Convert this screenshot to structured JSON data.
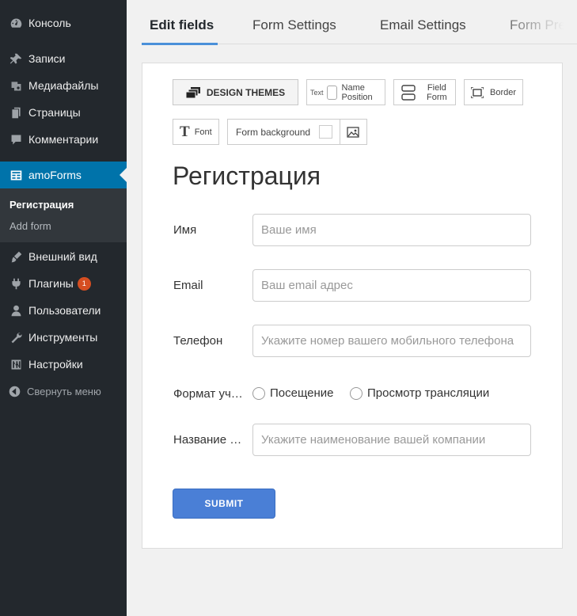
{
  "sidebar": {
    "items": [
      {
        "label": "Консоль",
        "icon": "dashboard-icon"
      },
      {
        "label": "Записи",
        "icon": "pin-icon"
      },
      {
        "label": "Медиафайлы",
        "icon": "media-icon"
      },
      {
        "label": "Страницы",
        "icon": "pages-icon"
      },
      {
        "label": "Комментарии",
        "icon": "comments-icon"
      },
      {
        "label": "amoForms",
        "icon": "forms-icon"
      },
      {
        "label": "Внешний вид",
        "icon": "appearance-icon"
      },
      {
        "label": "Плагины",
        "icon": "plugins-icon",
        "badge": "1"
      },
      {
        "label": "Пользователи",
        "icon": "users-icon"
      },
      {
        "label": "Инструменты",
        "icon": "tools-icon"
      },
      {
        "label": "Настройки",
        "icon": "settings-icon"
      }
    ],
    "submenu": {
      "current": "Регистрация",
      "add": "Add form"
    },
    "collapse": "Свернуть меню"
  },
  "tabs": [
    "Edit fields",
    "Form Settings",
    "Email Settings",
    "Form Preview"
  ],
  "toolbar": {
    "design_themes": "DESIGN THEMES",
    "text": "Text",
    "name_position_1": "Name",
    "name_position_2": "Position",
    "field_form_1": "Field",
    "field_form_2": "Form",
    "border": "Border",
    "font": "Font",
    "form_background": "Form background"
  },
  "form": {
    "title": "Регистрация",
    "fields": [
      {
        "label": "Имя",
        "placeholder": "Ваше имя"
      },
      {
        "label": "Email",
        "placeholder": "Ваш email адрес"
      },
      {
        "label": "Телефон",
        "placeholder": "Укажите номер вашего мобильного телефона"
      },
      {
        "label": "Формат уч…"
      },
      {
        "label": "Название …",
        "placeholder": "Укажите наименование вашей компании"
      }
    ],
    "radio_options": [
      "Посещение",
      "Просмотр трансляции"
    ],
    "submit": "SUBMIT"
  },
  "colors": {
    "sidebar_bg": "#23282d",
    "active": "#0073aa",
    "accent": "#4a90d9",
    "submit": "#4a7fd6",
    "badge": "#d54e21"
  }
}
